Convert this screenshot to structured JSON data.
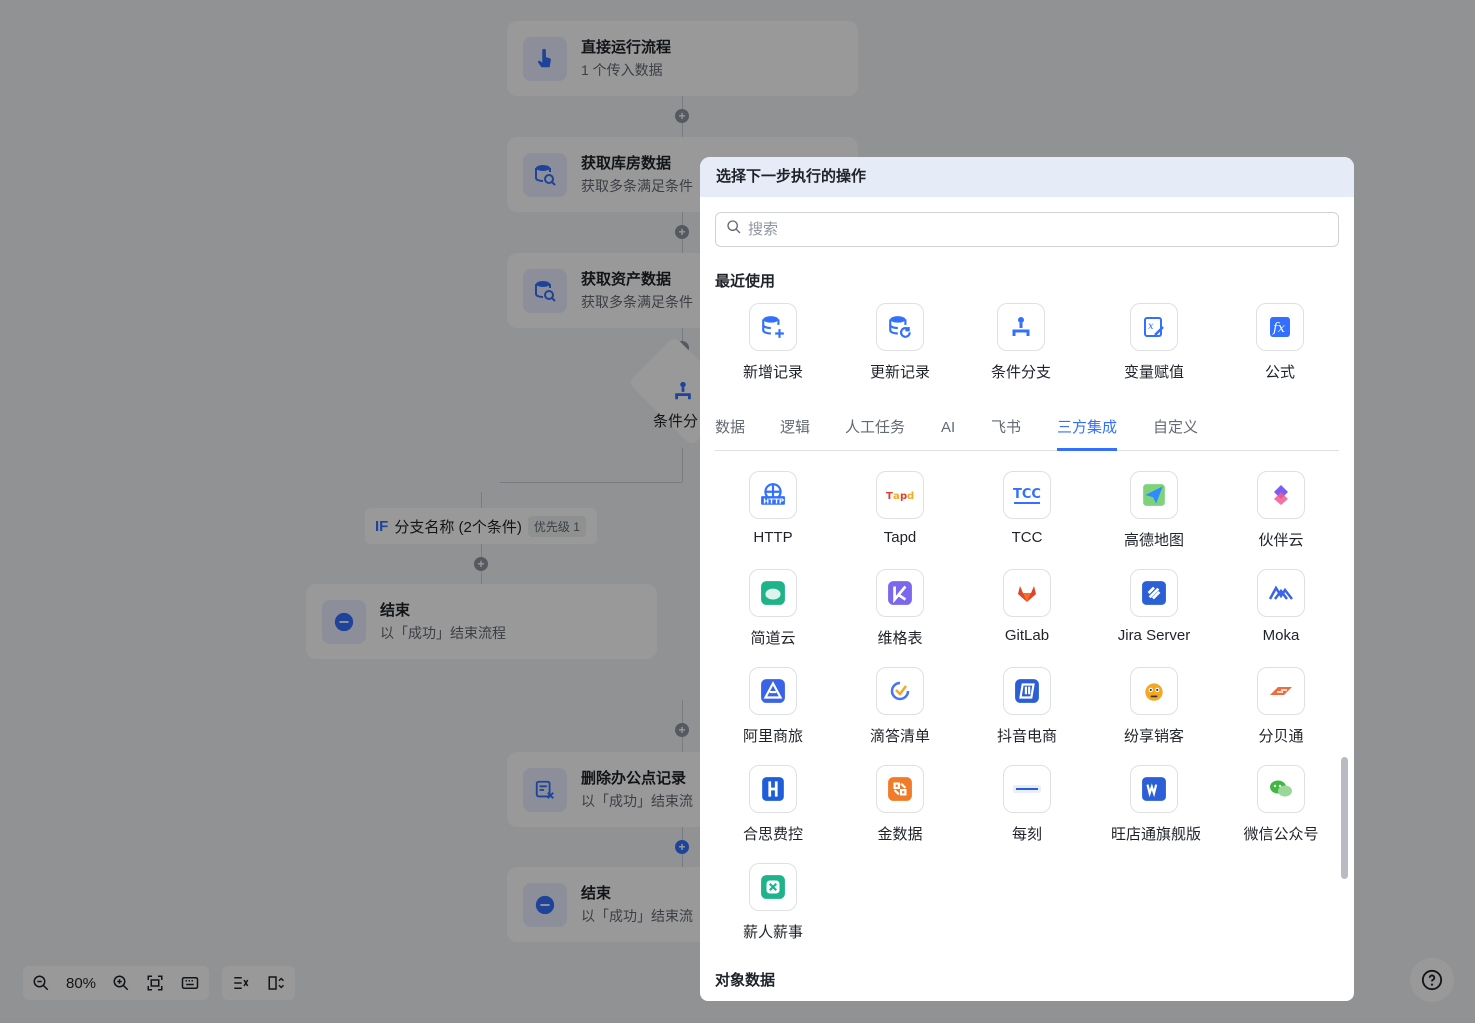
{
  "canvas": {
    "nodes": [
      {
        "title": "直接运行流程",
        "sub": "1 个传入数据",
        "icon": "hand-pointer-icon"
      },
      {
        "title": "获取库房数据",
        "sub": "获取多条满足条件",
        "icon": "database-search-icon"
      },
      {
        "title": "获取资产数据",
        "sub": "获取多条满足条件",
        "icon": "database-search-icon"
      },
      {
        "title": "结束",
        "sub": "以「成功」结束流程",
        "icon": "minus-circle-icon"
      },
      {
        "title": "删除办公点记录",
        "sub": "以「成功」结束流",
        "icon": "delete-record-icon"
      },
      {
        "title": "结束",
        "sub": "以「成功」结束流",
        "icon": "minus-circle-icon"
      }
    ],
    "condition": {
      "label": "条件分"
    },
    "if_branch": {
      "tag": "IF",
      "name": "分支名称 (2个条件)",
      "priority": "优先级 1"
    }
  },
  "panel": {
    "header": "选择下一步执行的操作",
    "search_placeholder": "搜索",
    "recent_title": "最近使用",
    "recent": [
      {
        "label": "新增记录",
        "icon": "add-record-icon"
      },
      {
        "label": "更新记录",
        "icon": "update-record-icon"
      },
      {
        "label": "条件分支",
        "icon": "branch-icon"
      },
      {
        "label": "变量赋值",
        "icon": "variable-icon"
      },
      {
        "label": "公式",
        "icon": "formula-icon"
      }
    ],
    "tabs": [
      "数据",
      "逻辑",
      "人工任务",
      "AI",
      "飞书",
      "三方集成",
      "自定义"
    ],
    "active_tab": "三方集成",
    "integrations": [
      {
        "label": "HTTP",
        "icon": "http-icon",
        "color": "#3370ff"
      },
      {
        "label": "Tapd",
        "icon": "tapd-icon",
        "color": "#e43b2c"
      },
      {
        "label": "TCC",
        "icon": "tcc-icon",
        "color": "#3370ff"
      },
      {
        "label": "高德地图",
        "icon": "amap-icon",
        "color": "#2f8bff"
      },
      {
        "label": "伙伴云",
        "icon": "huoban-icon",
        "color": "#7b5cf5"
      },
      {
        "label": "简道云",
        "icon": "jiandaoyun-icon",
        "color": "#1fb38a"
      },
      {
        "label": "维格表",
        "icon": "vika-icon",
        "color": "#7b67ee"
      },
      {
        "label": "GitLab",
        "icon": "gitlab-icon",
        "color": "#e2432a"
      },
      {
        "label": "Jira Server",
        "icon": "jira-icon",
        "color": "#2c5fd6"
      },
      {
        "label": "Moka",
        "icon": "moka-icon",
        "color": "#3a64e8"
      },
      {
        "label": "阿里商旅",
        "icon": "alibtrip-icon",
        "color": "#3a64e8"
      },
      {
        "label": "滴答清单",
        "icon": "ticktick-icon",
        "color": "#4772fa"
      },
      {
        "label": "抖音电商",
        "icon": "douyin-shop-icon",
        "color": "#2c5fd6"
      },
      {
        "label": "纷享销客",
        "icon": "fxiaoke-icon",
        "color": "#f5a623"
      },
      {
        "label": "分贝通",
        "icon": "fenbeitong-icon",
        "color": "#f26b3a"
      },
      {
        "label": "合思费控",
        "icon": "hose-icon",
        "color": "#1e5fd9"
      },
      {
        "label": "金数据",
        "icon": "jinshuju-icon",
        "color": "#f07c2a"
      },
      {
        "label": "每刻",
        "icon": "maycur-icon",
        "color": "#2c5fd6"
      },
      {
        "label": "旺店通旗舰版",
        "icon": "wangdiantong-icon",
        "color": "#2c5fd6"
      },
      {
        "label": "微信公众号",
        "icon": "wechat-icon",
        "color": "#3fb83f"
      },
      {
        "label": "薪人薪事",
        "icon": "xinrenxinshi-icon",
        "color": "#1fb38a"
      }
    ],
    "object_title": "对象数据"
  },
  "toolbar": {
    "zoom": "80%"
  }
}
